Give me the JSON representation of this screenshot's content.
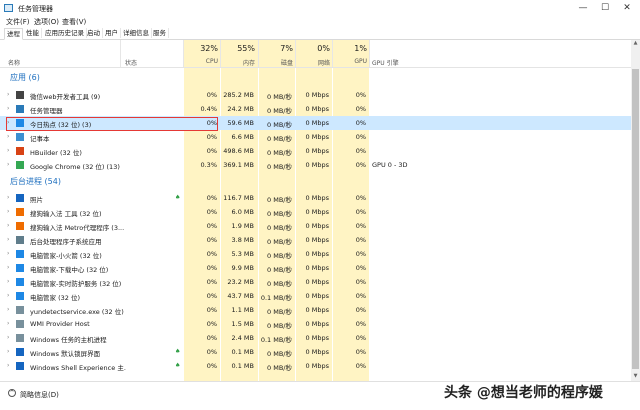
{
  "window": {
    "title": "任务管理器",
    "controls": {
      "minimize": "—",
      "maximize": "☐",
      "close": "✕"
    }
  },
  "menu": [
    "文件(F)",
    "选项(O)",
    "查看(V)"
  ],
  "tabs": [
    "进程",
    "性能",
    "应用历史记录",
    "启动",
    "用户",
    "详细信息",
    "服务"
  ],
  "columns": {
    "name": "名称",
    "status": "状态",
    "cpu": {
      "pct": "32%",
      "label": "CPU"
    },
    "memory": {
      "pct": "55%",
      "label": "内存"
    },
    "disk": {
      "pct": "7%",
      "label": "磁盘"
    },
    "network": {
      "pct": "0%",
      "label": "网络"
    },
    "gpu": {
      "pct": "1%",
      "label": "GPU"
    },
    "gpu_engine": {
      "label": "GPU 引擎"
    }
  },
  "sections": {
    "apps": "应用 (6)",
    "background": "后台进程 (54)"
  },
  "apps": [
    {
      "name": "微信web开发者工具 (9)",
      "cpu": "0%",
      "memory": "285.2 MB",
      "disk": "0 MB/秒",
      "network": "0 Mbps",
      "gpu": "0%",
      "gpu_engine": "",
      "icon": "wechat-devtools-icon",
      "color": "#444444"
    },
    {
      "name": "任务管理器",
      "cpu": "0.4%",
      "memory": "24.2 MB",
      "disk": "0 MB/秒",
      "network": "0 Mbps",
      "gpu": "0%",
      "gpu_engine": "",
      "icon": "task-manager-icon",
      "color": "#2a7ab8"
    },
    {
      "name": "今日热点 (32 位) (3)",
      "cpu": "0%",
      "memory": "59.6 MB",
      "disk": "0 MB/秒",
      "network": "0 Mbps",
      "gpu": "0%",
      "gpu_engine": "",
      "icon": "news-icon",
      "color": "#1e88e5"
    },
    {
      "name": "记事本",
      "cpu": "0%",
      "memory": "6.6 MB",
      "disk": "0 MB/秒",
      "network": "0 Mbps",
      "gpu": "0%",
      "gpu_engine": "",
      "icon": "notepad-icon",
      "color": "#3d8fd1"
    },
    {
      "name": "HBuilder (32 位)",
      "cpu": "0%",
      "memory": "498.6 MB",
      "disk": "0 MB/秒",
      "network": "0 Mbps",
      "gpu": "0%",
      "gpu_engine": "",
      "icon": "hbuilder-icon",
      "color": "#d84315"
    },
    {
      "name": "Google Chrome (32 位) (13)",
      "cpu": "0.3%",
      "memory": "369.1 MB",
      "disk": "0 MB/秒",
      "network": "0 Mbps",
      "gpu": "0%",
      "gpu_engine": "GPU 0 - 3D",
      "icon": "chrome-icon",
      "color": "#34a853"
    }
  ],
  "background": [
    {
      "name": "照片",
      "cpu": "0%",
      "memory": "116.7 MB",
      "disk": "0 MB/秒",
      "network": "0 Mbps",
      "gpu": "0%",
      "icon": "photos-icon",
      "color": "#1565c0",
      "leaf": true
    },
    {
      "name": "搜狗输入法 工具 (32 位)",
      "cpu": "0%",
      "memory": "6.0 MB",
      "disk": "0 MB/秒",
      "network": "0 Mbps",
      "gpu": "0%",
      "icon": "sogou-icon",
      "color": "#ef6c00",
      "leaf": false
    },
    {
      "name": "搜狗输入法 Metro代理程序 (3...",
      "cpu": "0%",
      "memory": "1.9 MB",
      "disk": "0 MB/秒",
      "network": "0 Mbps",
      "gpu": "0%",
      "icon": "sogou-icon",
      "color": "#ef6c00",
      "leaf": false
    },
    {
      "name": "后台处理程序子系统应用",
      "cpu": "0%",
      "memory": "3.8 MB",
      "disk": "0 MB/秒",
      "network": "0 Mbps",
      "gpu": "0%",
      "icon": "spooler-icon",
      "color": "#607d8b",
      "leaf": false
    },
    {
      "name": "电脑管家-小火箭 (32 位)",
      "cpu": "0%",
      "memory": "5.3 MB",
      "disk": "0 MB/秒",
      "network": "0 Mbps",
      "gpu": "0%",
      "icon": "pc-manager-icon",
      "color": "#1e88e5",
      "leaf": false
    },
    {
      "name": "电脑管家-下载中心 (32 位)",
      "cpu": "0%",
      "memory": "9.9 MB",
      "disk": "0 MB/秒",
      "network": "0 Mbps",
      "gpu": "0%",
      "icon": "pc-manager-icon",
      "color": "#1e88e5",
      "leaf": false
    },
    {
      "name": "电脑管家-实时防护服务 (32 位)",
      "cpu": "0%",
      "memory": "23.2 MB",
      "disk": "0 MB/秒",
      "network": "0 Mbps",
      "gpu": "0%",
      "icon": "pc-manager-icon",
      "color": "#1e88e5",
      "leaf": false
    },
    {
      "name": "电脑管家 (32 位)",
      "cpu": "0%",
      "memory": "43.7 MB",
      "disk": "0.1 MB/秒",
      "network": "0 Mbps",
      "gpu": "0%",
      "icon": "pc-manager-icon",
      "color": "#1e88e5",
      "leaf": false
    },
    {
      "name": "yundetectservice.exe (32 位)",
      "cpu": "0%",
      "memory": "1.1 MB",
      "disk": "0 MB/秒",
      "network": "0 Mbps",
      "gpu": "0%",
      "icon": "service-icon",
      "color": "#78909c",
      "leaf": false
    },
    {
      "name": "WMI Provider Host",
      "cpu": "0%",
      "memory": "1.5 MB",
      "disk": "0 MB/秒",
      "network": "0 Mbps",
      "gpu": "0%",
      "icon": "wmi-icon",
      "color": "#78909c",
      "leaf": false
    },
    {
      "name": "Windows 任务的主机进程",
      "cpu": "0%",
      "memory": "2.4 MB",
      "disk": "0.1 MB/秒",
      "network": "0 Mbps",
      "gpu": "0%",
      "icon": "host-process-icon",
      "color": "#78909c",
      "leaf": false
    },
    {
      "name": "Windows 默认锁屏界面",
      "cpu": "0%",
      "memory": "0.1 MB",
      "disk": "0 MB/秒",
      "network": "0 Mbps",
      "gpu": "0%",
      "icon": "lockscreen-icon",
      "color": "#1565c0",
      "leaf": true
    },
    {
      "name": "Windows Shell Experience 主...",
      "cpu": "0%",
      "memory": "0.1 MB",
      "disk": "0 MB/秒",
      "network": "0 Mbps",
      "gpu": "0%",
      "icon": "shell-icon",
      "color": "#1565c0",
      "leaf": true
    }
  ],
  "footer": {
    "label": "简略信息(D)"
  },
  "watermark": "头条 @想当老师的程序媛",
  "colors": {
    "heat": "#fff4c4",
    "section": "#1e6fbf",
    "selection": "#cde8ff",
    "annotation": "#e53935"
  }
}
